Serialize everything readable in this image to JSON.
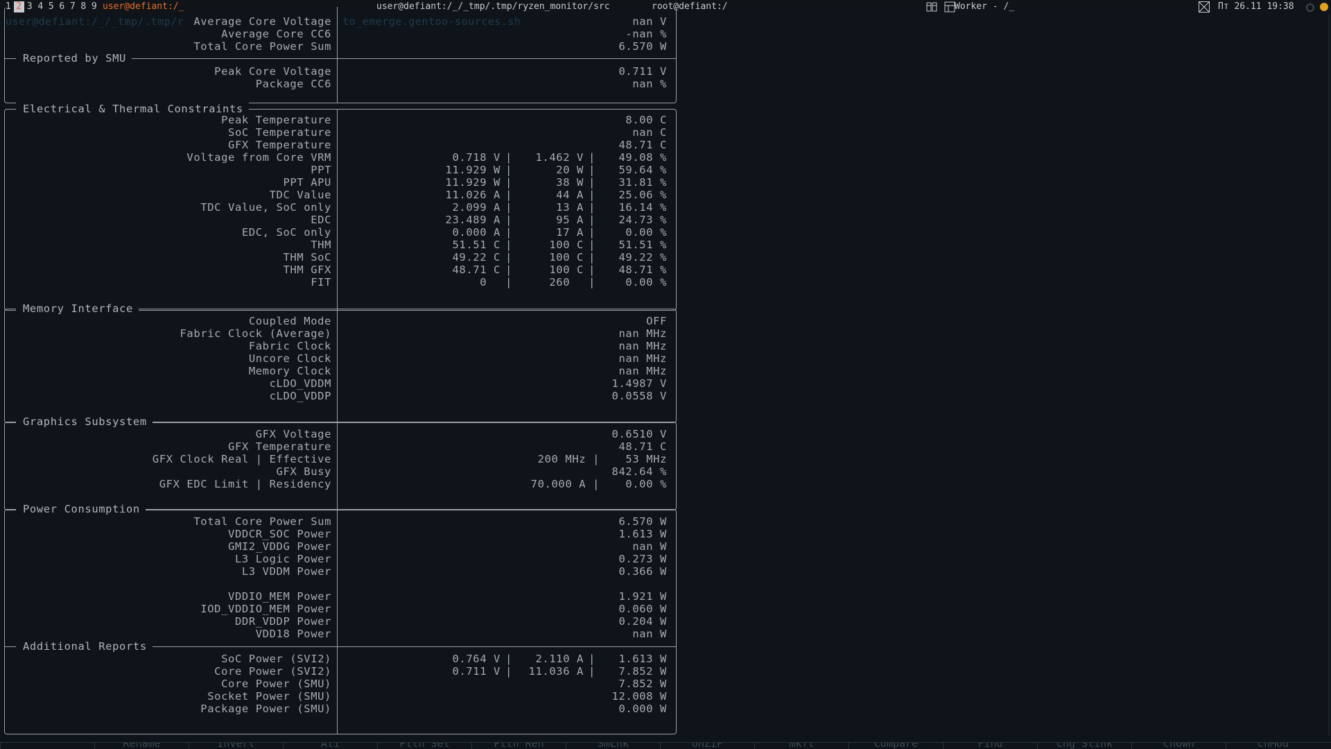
{
  "topbar": {
    "workspaces": [
      "1",
      "2",
      "3",
      "4",
      "5",
      "6",
      "7",
      "8",
      "9"
    ],
    "active_window": "user@defiant:/_",
    "center_title": "user@defiant:/_/_tmp/.tmp/ryzen_monitor/src",
    "right_title": "root@defiant:/",
    "task_title": "Worker - /_",
    "clock": "Пт 26.11 19:38"
  },
  "ghost_prompt": "user@defiant:/_/_tmp/.tmp/r                        to_emerge.gentoo-sources.sh",
  "top_rows": [
    {
      "label": "Average Core Voltage",
      "value": "nan V"
    },
    {
      "label": "Average Core CC6",
      "value": "-nan %"
    },
    {
      "label": "Total Core Power Sum",
      "value": "6.570 W"
    }
  ],
  "smu": {
    "title": "Reported by SMU",
    "rows": [
      {
        "label": "Peak Core Voltage",
        "value": "0.711 V"
      },
      {
        "label": "Package CC6",
        "value": "nan %"
      }
    ]
  },
  "electrical": {
    "title": "Electrical & Thermal Constraints",
    "rows": [
      {
        "label": "Peak Temperature",
        "v1": "",
        "v2": "",
        "value": "8.00 C"
      },
      {
        "label": "SoC Temperature",
        "v1": "",
        "v2": "",
        "value": "nan C"
      },
      {
        "label": "GFX Temperature",
        "v1": "",
        "v2": "",
        "value": "48.71 C"
      },
      {
        "label": "Voltage from Core VRM",
        "v1": "0.718 V",
        "v2": "1.462 V",
        "value": "49.08 %"
      },
      {
        "label": "PPT",
        "v1": "11.929 W",
        "v2": "20 W",
        "value": "59.64 %"
      },
      {
        "label": "PPT APU",
        "v1": "11.929 W",
        "v2": "38 W",
        "value": "31.81 %"
      },
      {
        "label": "TDC Value",
        "v1": "11.026 A",
        "v2": "44 A",
        "value": "25.06 %"
      },
      {
        "label": "TDC Value, SoC only",
        "v1": "2.099 A",
        "v2": "13 A",
        "value": "16.14 %"
      },
      {
        "label": "EDC",
        "v1": "23.489 A",
        "v2": "95 A",
        "value": "24.73 %"
      },
      {
        "label": "EDC, SoC only",
        "v1": "0.000 A",
        "v2": "17 A",
        "value": "0.00 %"
      },
      {
        "label": "THM",
        "v1": "51.51 C",
        "v2": "100 C",
        "value": "51.51 %"
      },
      {
        "label": "THM SoC",
        "v1": "49.22 C",
        "v2": "100 C",
        "value": "49.22 %"
      },
      {
        "label": "THM GFX",
        "v1": "48.71 C",
        "v2": "100 C",
        "value": "48.71 %"
      },
      {
        "label": "FIT",
        "v1": "0  ",
        "v2": "260  ",
        "value": "0.00 %"
      }
    ]
  },
  "memory": {
    "title": "Memory Interface",
    "rows": [
      {
        "label": "Coupled Mode",
        "value": "OFF"
      },
      {
        "label": "Fabric Clock (Average)",
        "value": "nan MHz"
      },
      {
        "label": "Fabric Clock",
        "value": "nan MHz"
      },
      {
        "label": "Uncore Clock",
        "value": "nan MHz"
      },
      {
        "label": "Memory Clock",
        "value": "nan MHz"
      },
      {
        "label": "cLDO_VDDM",
        "value": "1.4987 V"
      },
      {
        "label": "cLDO_VDDP",
        "value": "0.0558 V"
      }
    ]
  },
  "graphics": {
    "title": "Graphics Subsystem",
    "rows": [
      {
        "label": "GFX Voltage",
        "v1": "",
        "value": "0.6510 V"
      },
      {
        "label": "GFX Temperature",
        "v1": "",
        "value": "48.71 C"
      },
      {
        "label": "GFX Clock Real | Effective",
        "v1": "200 MHz |",
        "value": "53 MHz"
      },
      {
        "label": "GFX Busy",
        "v1": "",
        "value": "842.64 %"
      },
      {
        "label": "GFX EDC Limit | Residency",
        "v1": "70.000 A |",
        "value": "0.00 %"
      }
    ]
  },
  "power": {
    "title": "Power Consumption",
    "rows": [
      {
        "label": "Total Core Power Sum",
        "value": "6.570 W"
      },
      {
        "label": "VDDCR_SOC Power",
        "value": "1.613 W"
      },
      {
        "label": "GMI2_VDDG Power",
        "value": "nan W"
      },
      {
        "label": "L3 Logic Power",
        "value": "0.273 W"
      },
      {
        "label": "L3 VDDM Power",
        "value": "0.366 W"
      },
      {
        "label": "",
        "value": ""
      },
      {
        "label": "VDDIO_MEM Power",
        "value": "1.921 W"
      },
      {
        "label": "IOD_VDDIO_MEM Power",
        "value": "0.060 W"
      },
      {
        "label": "DDR_VDDP Power",
        "value": "0.204 W"
      },
      {
        "label": "VDD18 Power",
        "value": "nan W"
      }
    ]
  },
  "additional": {
    "title": "Additional Reports",
    "rows": [
      {
        "label": "SoC Power (SVI2)",
        "v1": "0.764 V",
        "v2": "2.110 A",
        "value": "1.613 W"
      },
      {
        "label": "Core Power (SVI2)",
        "v1": "0.711 V",
        "v2": "11.036 A",
        "value": "7.852 W"
      },
      {
        "label": "Core Power (SMU)",
        "v1": "",
        "v2": "",
        "value": "7.852 W"
      },
      {
        "label": "Socket Power (SMU)",
        "v1": "",
        "v2": "",
        "value": "12.008 W"
      },
      {
        "label": "Package Power (SMU)",
        "v1": "",
        "v2": "",
        "value": "0.000 W"
      }
    ]
  },
  "function_keys": [
    "",
    "Rename",
    "Invert",
    "Ali",
    "Pttn Sel",
    "Pttn Ren",
    "SmLnk",
    "UnZIP",
    "mkfl",
    "Compare",
    "Find",
    "Chg Slink",
    "ChOwn",
    "ChMod"
  ]
}
